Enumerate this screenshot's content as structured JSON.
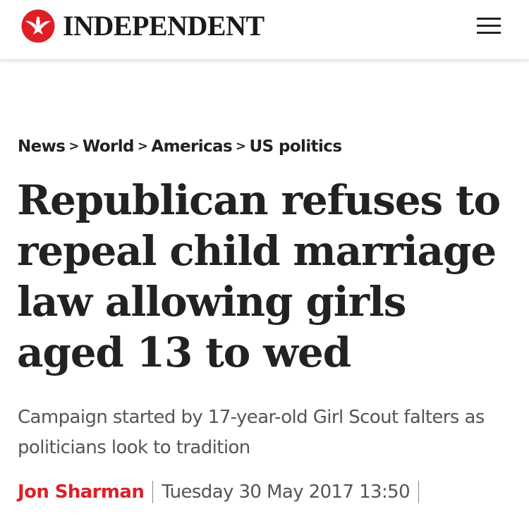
{
  "header": {
    "logo_text": "INDEPENDENT",
    "logo_icon": "eagle-icon",
    "menu_icon": "hamburger-menu-icon",
    "brand_color": "#dd1f26"
  },
  "breadcrumb": {
    "items": [
      "News",
      "World",
      "Americas",
      "US politics"
    ],
    "separator": ">"
  },
  "article": {
    "headline": "Republican refuses to repeal child marriage law allowing girls aged 13 to wed",
    "standfirst": "Campaign started by 17-year-old Girl Scout falters as politicians look to tradition",
    "author": "Jon Sharman",
    "date": "Tuesday 30 May 2017 13:50"
  }
}
